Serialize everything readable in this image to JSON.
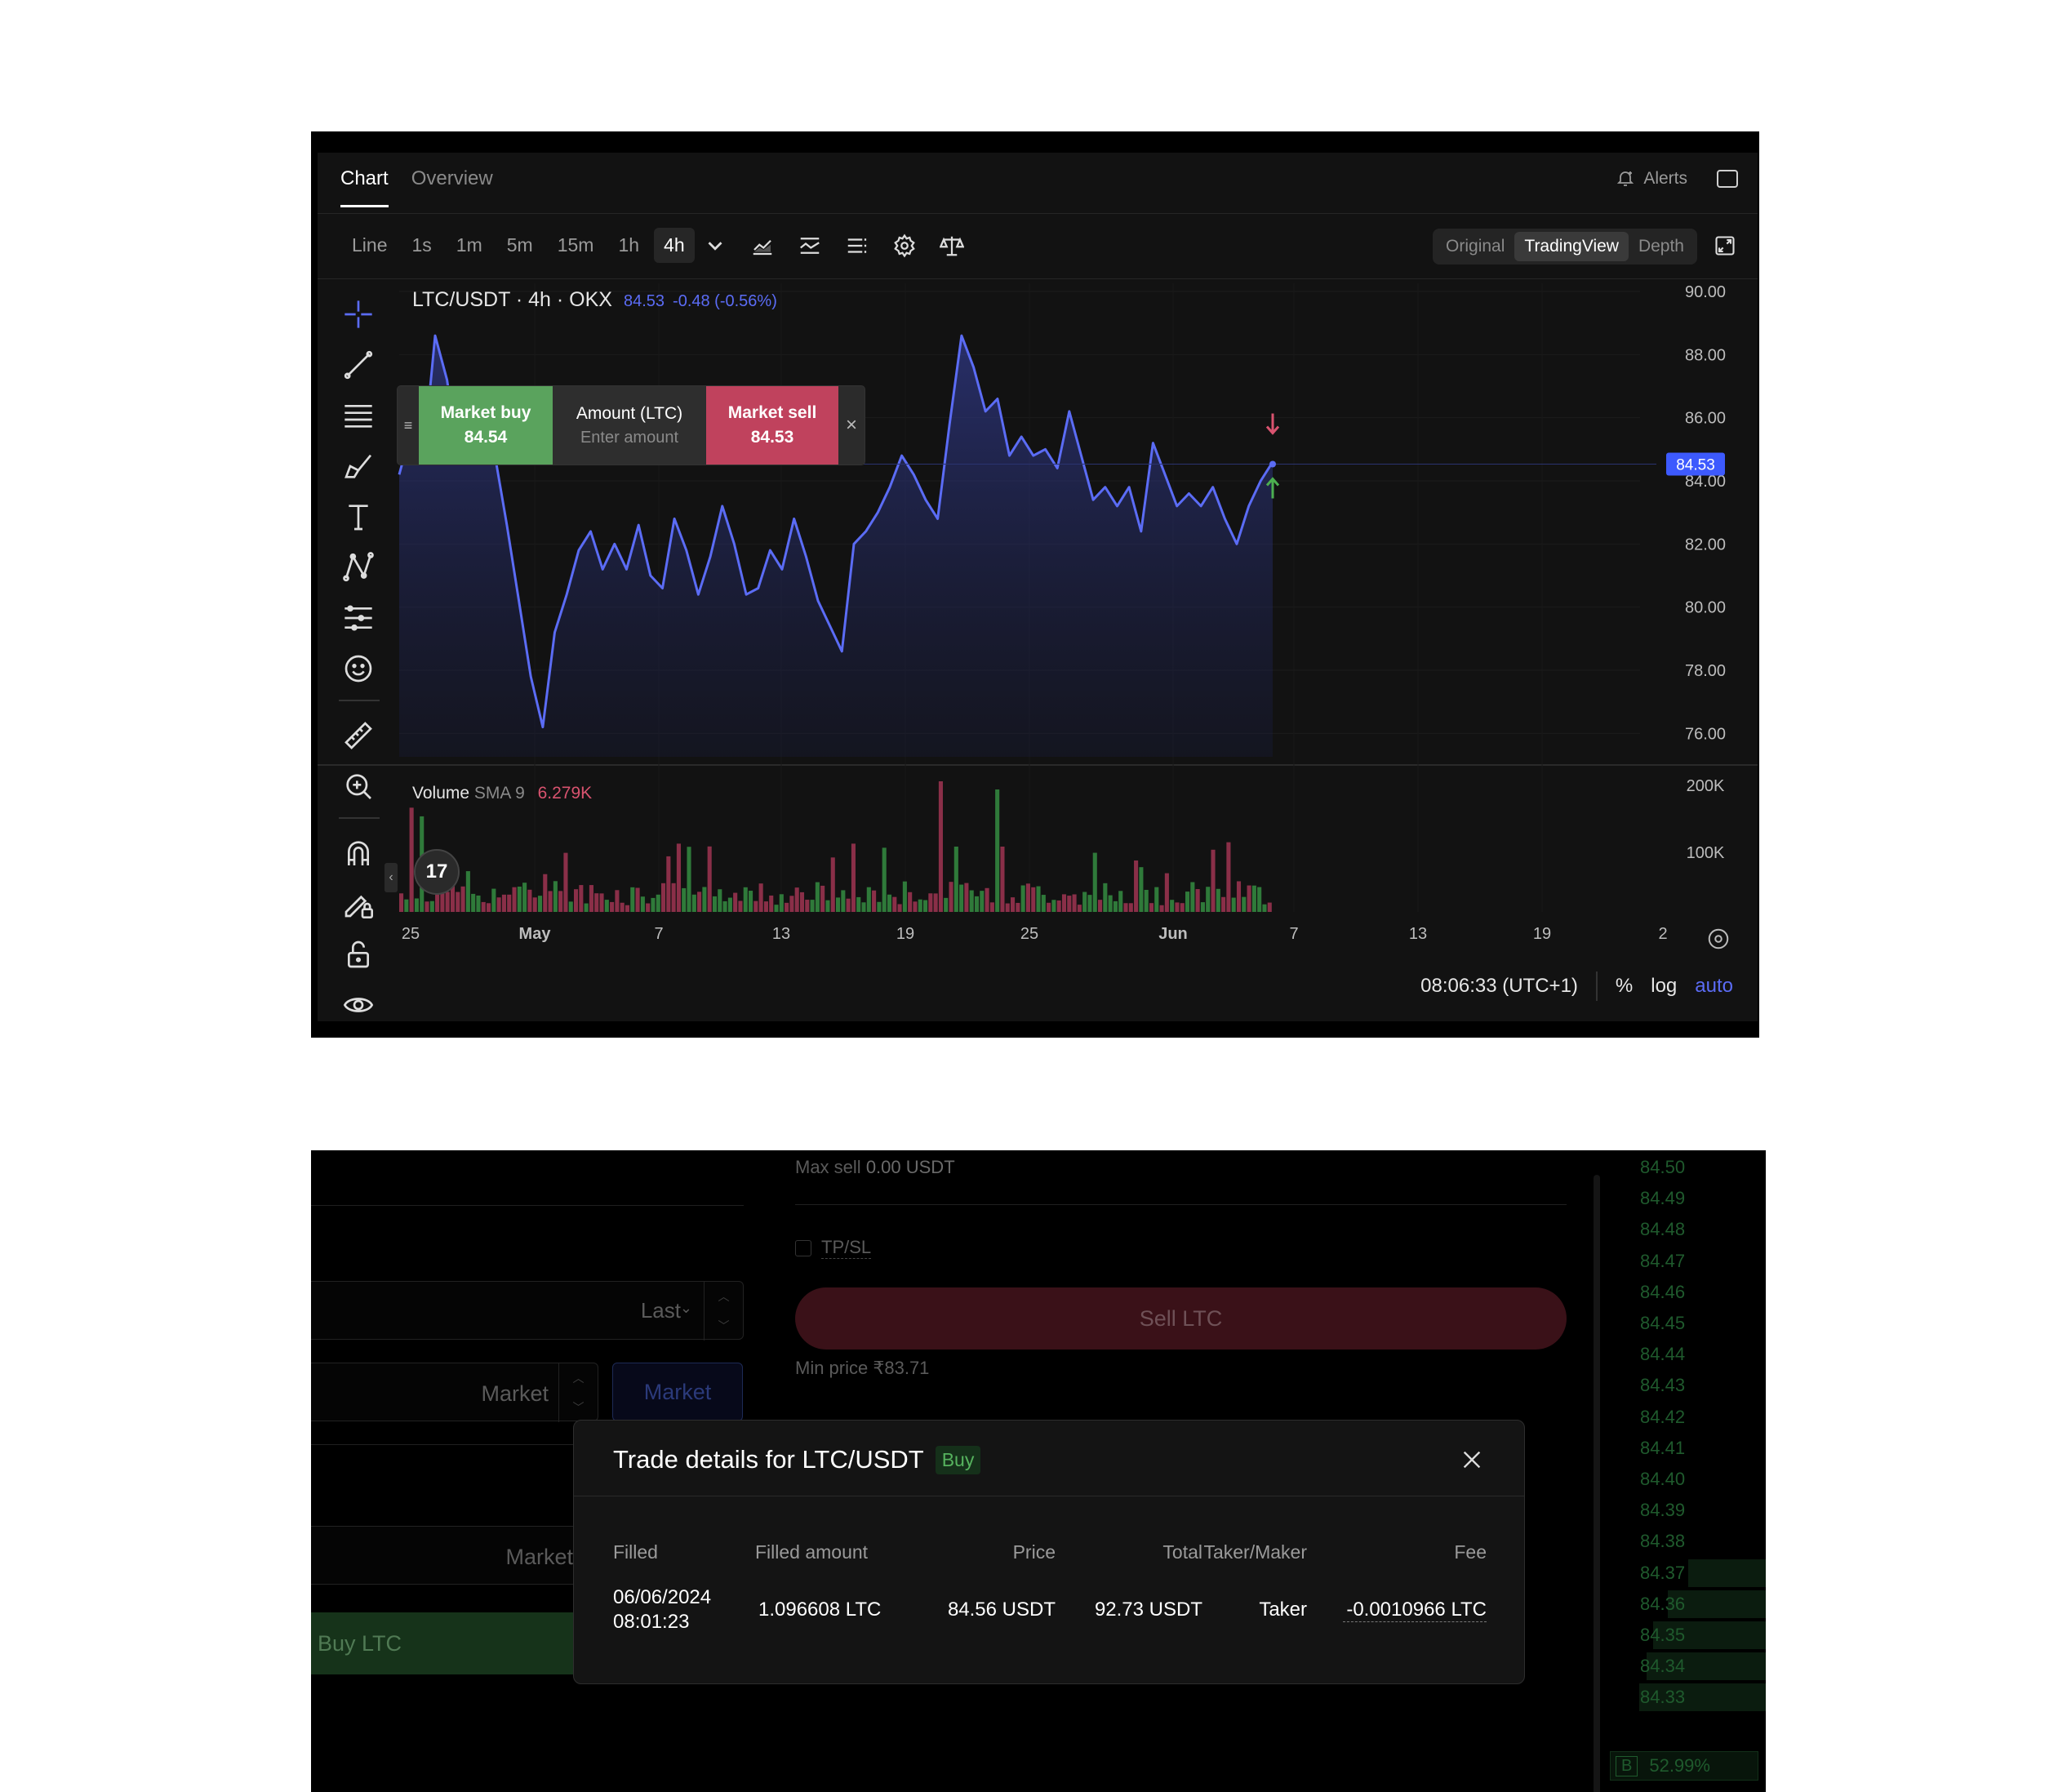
{
  "chart_panel": {
    "tabs": [
      {
        "label": "Chart"
      },
      {
        "label": "Overview"
      }
    ],
    "alerts_label": "Alerts",
    "toolbar": {
      "timeframes": [
        "Line",
        "1s",
        "1m",
        "5m",
        "15m",
        "1h",
        "4h"
      ],
      "active_timeframe": "4h"
    },
    "view_modes": [
      "Original",
      "TradingView",
      "Depth"
    ],
    "active_view": "TradingView",
    "legend": {
      "symbol": "LTC/USDT · 4h · OKX",
      "price": "84.53",
      "change": "-0.48 (-0.56%)"
    },
    "order_widget": {
      "buy_label": "Market buy",
      "buy_price": "84.54",
      "amount_label": "Amount (LTC)",
      "amount_placeholder": "Enter amount",
      "sell_label": "Market sell",
      "sell_price": "84.53",
      "close": "×"
    },
    "volume_legend": {
      "label": "Volume",
      "sma": "SMA 9",
      "value": "6.279K"
    },
    "price_axis_labels": [
      "90.00",
      "88.00",
      "86.00",
      "84.00",
      "82.00",
      "80.00",
      "78.00",
      "76.00"
    ],
    "volume_axis_labels": [
      "200K",
      "100K"
    ],
    "current_price_tag": "84.53",
    "x_axis_labels": [
      "25",
      "May",
      "7",
      "13",
      "19",
      "25",
      "Jun",
      "7",
      "13",
      "19",
      "2"
    ],
    "time_display": "08:06:33 (UTC+1)",
    "scale_options": [
      "%",
      "log",
      "auto"
    ],
    "logo_text": "17",
    "colors": {
      "line": "#5b6cf5",
      "up": "#4caf50",
      "down": "#d9536f",
      "price_tag": "#3d5afe"
    }
  },
  "chart_data": {
    "type": "line",
    "title": "LTC/USDT · 4h · OKX",
    "ylim": [
      75,
      90
    ],
    "x_range_days": [
      "2024-04-25",
      "2024-06-23"
    ],
    "last_value": 84.53,
    "series": [
      {
        "name": "LTC/USDT",
        "values": [
          84.2,
          85.6,
          84.6,
          88.6,
          87.2,
          84.6,
          85.4,
          86.8,
          84.8,
          82.6,
          80.2,
          77.8,
          76.2,
          79.2,
          80.4,
          81.8,
          82.4,
          81.2,
          82.0,
          81.2,
          82.6,
          81.0,
          80.6,
          82.8,
          81.8,
          80.4,
          81.6,
          83.2,
          82.0,
          80.4,
          80.6,
          81.8,
          81.2,
          82.8,
          81.6,
          80.2,
          79.4,
          78.6,
          82.0,
          82.4,
          83.0,
          83.8,
          84.8,
          84.2,
          83.4,
          82.8,
          85.8,
          88.6,
          87.6,
          86.2,
          86.6,
          84.8,
          85.4,
          84.8,
          85.0,
          84.4,
          86.2,
          84.8,
          83.4,
          83.8,
          83.2,
          83.8,
          82.4,
          85.2,
          84.2,
          83.2,
          83.6,
          83.2,
          83.8,
          82.8,
          82.0,
          83.2,
          84.0,
          84.6
        ]
      }
    ],
    "volume": {
      "sma": "6.279K",
      "ylim": [
        0,
        200000
      ]
    }
  },
  "trade_panel": {
    "max_sell_label": "Max sell",
    "max_sell_value": "0.00 USDT",
    "tpsl_label": "TP/SL",
    "last_label": "Last",
    "market_label": "Market",
    "market_tab": "Market",
    "market_label_2": "Market",
    "sell_button": "Sell LTC",
    "min_price": "Min price ₹83.71",
    "buy_button": "Buy LTC",
    "orderbook_prices": [
      "84.50",
      "84.49",
      "84.48",
      "84.47",
      "84.46",
      "84.45",
      "84.44",
      "84.43",
      "84.42",
      "84.41",
      "84.40",
      "84.39",
      "84.38",
      "84.37",
      "84.36",
      "84.35",
      "84.34",
      "84.33"
    ],
    "orderbook_bar_fractions": [
      0,
      0,
      0,
      0,
      0,
      0,
      0,
      0,
      0,
      0,
      0,
      0,
      0,
      0.55,
      0.7,
      0.8,
      0.85,
      0.9
    ],
    "buy_ratio_badge": "B",
    "buy_ratio": "52.99%"
  },
  "modal": {
    "title": "Trade details for LTC/USDT",
    "side_badge": "Buy",
    "headers": {
      "filled": "Filled",
      "filled_amount": "Filled amount",
      "price": "Price",
      "total": "Total",
      "taker_maker": "Taker/Maker",
      "fee": "Fee"
    },
    "row": {
      "date": "06/06/2024",
      "time": "08:01:23",
      "filled_amount": "1.096608 LTC",
      "price": "84.56 USDT",
      "total": "92.73 USDT",
      "taker_maker": "Taker",
      "fee": "-0.0010966 LTC"
    }
  }
}
